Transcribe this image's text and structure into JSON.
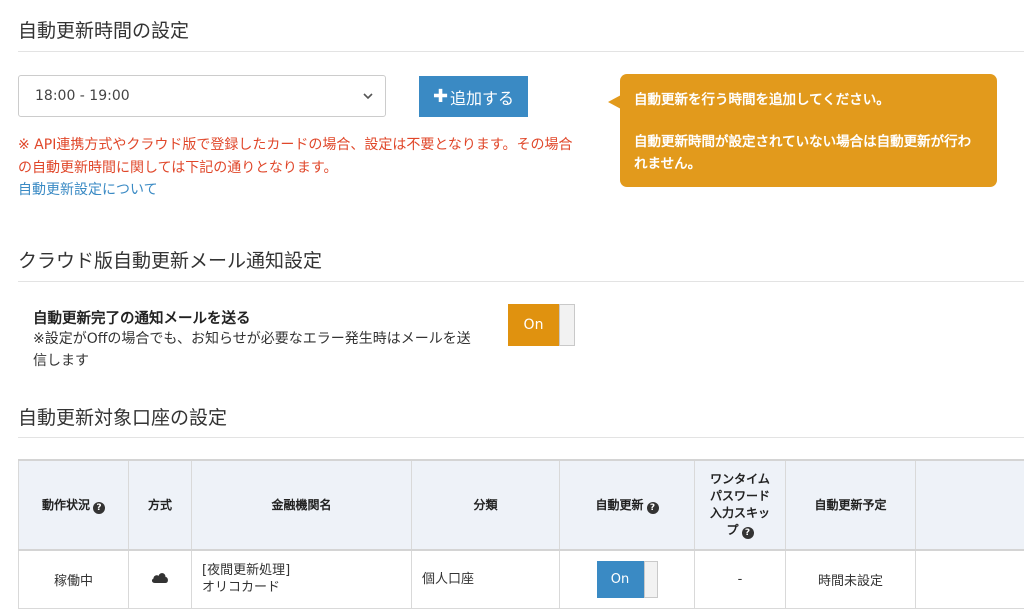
{
  "section_time": {
    "title": "自動更新時間の設定",
    "selected_time": "18:00 - 19:00",
    "add_label": "追加する",
    "warning": "※ API連携方式やクラウド版で登録したカードの場合、設定は不要となります。その場合の自動更新時間に関しては下記の通りとなります。",
    "link": "自動更新設定について",
    "tooltip_line1": "自動更新を行う時間を追加してください。",
    "tooltip_line2": "自動更新時間が設定されていない場合は自動更新が行われません。"
  },
  "section_mail": {
    "title": "クラウド版自動更新メール通知設定",
    "label": "自動更新完了の通知メールを送る",
    "note": "※設定がOffの場合でも、お知らせが必要なエラー発生時はメールを送信します",
    "toggle": "On"
  },
  "section_accounts": {
    "title": "自動更新対象口座の設定",
    "headers": {
      "status": "動作状況",
      "method": "方式",
      "institution": "金融機関名",
      "category": "分類",
      "auto_update": "自動更新",
      "otp_skip": "ワンタイムパスワード入力スキップ",
      "schedule": "自動更新予定"
    },
    "rows": [
      {
        "status": "稼働中",
        "method_icon": "cloud-icon",
        "institution_line1": "[夜間更新処理]",
        "institution_line2": "オリコカード",
        "category": "個人口座",
        "auto_update": "On",
        "otp_skip": "-",
        "schedule": "時間未設定"
      }
    ]
  },
  "colors": {
    "accent_blue": "#3a8ac4",
    "accent_orange": "#e29a1c",
    "warning_red": "#e0472a"
  }
}
